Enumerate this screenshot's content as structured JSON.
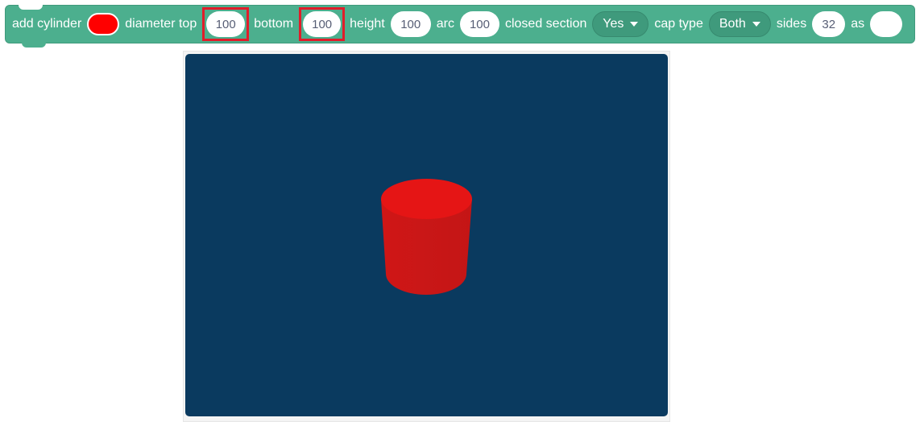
{
  "block": {
    "label_add": "add cylinder",
    "color": "#ff0000",
    "label_diameter_top": "diameter top",
    "diameter_top": "100",
    "label_bottom": "bottom",
    "bottom": "100",
    "label_height": "height",
    "height": "100",
    "label_arc": "arc",
    "arc": "100",
    "label_closed_section": "closed section",
    "closed_section": "Yes",
    "label_cap_type": "cap type",
    "cap_type": "Both",
    "label_sides": "sides",
    "sides": "32",
    "label_as": "as",
    "as_value": ""
  },
  "stage": {
    "background_color": "#0A3A5F",
    "object": "cylinder",
    "object_color": "#d71a1a"
  }
}
